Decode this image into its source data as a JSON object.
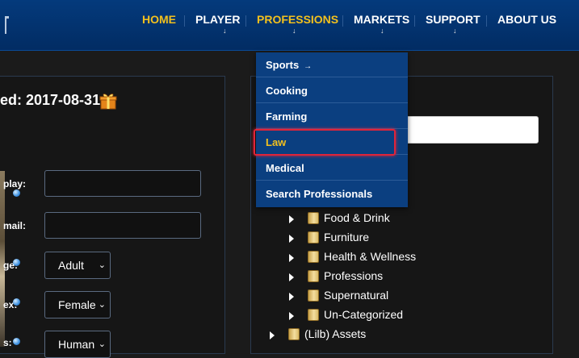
{
  "nav": {
    "items": [
      {
        "label": "HOME",
        "has_arrow": false
      },
      {
        "label": "PLAYER",
        "has_arrow": true
      },
      {
        "label": "PROFESSIONS",
        "has_arrow": true
      },
      {
        "label": "MARKETS",
        "has_arrow": true
      },
      {
        "label": "SUPPORT",
        "has_arrow": true
      },
      {
        "label": "ABOUT US",
        "has_arrow": false
      }
    ],
    "arrow_glyph": "↓"
  },
  "profile": {
    "registered_text": "ed: 2017-08-31",
    "labels": {
      "display": "play:",
      "email": "mail:",
      "age": "ge:",
      "sex": "ex:",
      "species": "s:"
    },
    "age_value": "Adult",
    "sex_value": "Female",
    "species_value": "Human"
  },
  "dropdown": {
    "items": [
      {
        "label": "Sports",
        "submenu": "→"
      },
      {
        "label": "Cooking"
      },
      {
        "label": "Farming"
      },
      {
        "label": "Law",
        "highlighted": true
      },
      {
        "label": "Medical"
      },
      {
        "label": "Search Professionals"
      }
    ]
  },
  "tree": {
    "items": [
      {
        "label": "Food & Drink"
      },
      {
        "label": "Furniture"
      },
      {
        "label": "Health & Wellness"
      },
      {
        "label": "Professions"
      },
      {
        "label": "Supernatural"
      },
      {
        "label": "Un-Categorized"
      }
    ],
    "root": {
      "label": "(Lilb) Assets"
    }
  },
  "colors": {
    "header_bg": "#043a7c",
    "accent_gold": "#f2c01e",
    "highlight_red": "#e0243a"
  }
}
